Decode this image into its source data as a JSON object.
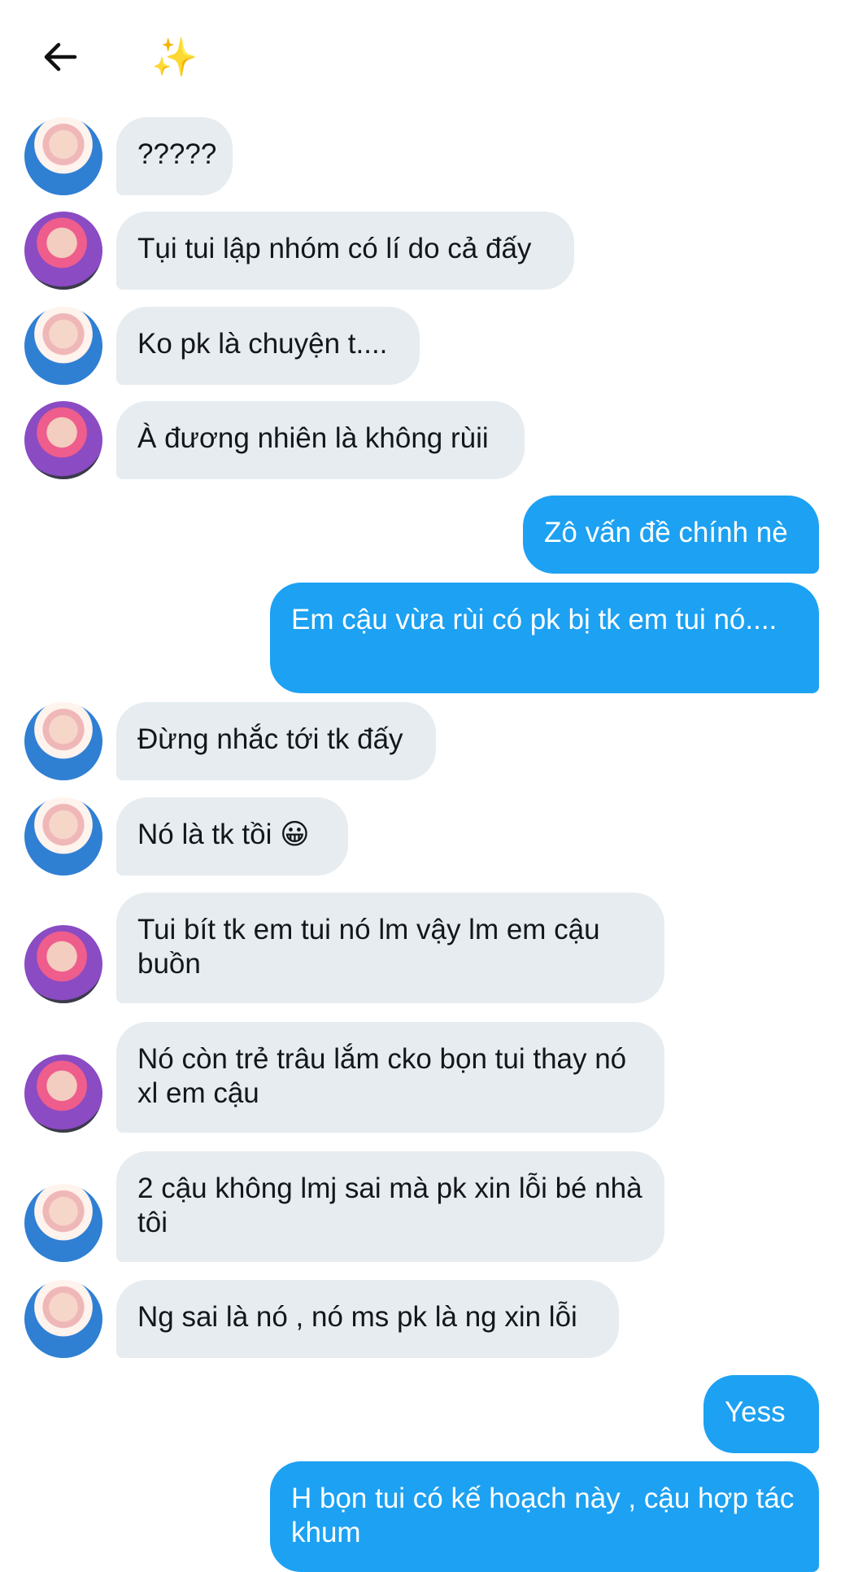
{
  "header": {
    "back_icon": "arrow-left-icon",
    "title": "✨"
  },
  "colors": {
    "incoming_bg": "#e6ecf0",
    "outgoing_bg": "#1da1f2",
    "incoming_text": "#14171a",
    "outgoing_text": "#ffffff"
  },
  "messages": [
    {
      "side": "in",
      "avatar": "a",
      "text": "?????"
    },
    {
      "side": "in",
      "avatar": "b",
      "text": "Tụi tui lập nhóm có lí do cả đấy"
    },
    {
      "side": "in",
      "avatar": "a",
      "text": "Ko pk là chuyện t...."
    },
    {
      "side": "in",
      "avatar": "b",
      "text": "À đương nhiên là không rùii"
    },
    {
      "side": "out",
      "text": "Zô vấn đề chính nè"
    },
    {
      "side": "out",
      "text": "Em cậu vừa rùi có pk bị tk em tui nó...."
    },
    {
      "side": "in",
      "avatar": "a",
      "text": "Đừng nhắc tới tk đấy"
    },
    {
      "side": "in",
      "avatar": "a",
      "text": "Nó là tk tồi 😀"
    },
    {
      "side": "in",
      "avatar": "b",
      "text": "Tui bít tk em tui nó lm vậy lm em cậu buồn"
    },
    {
      "side": "in",
      "avatar": "b",
      "text": "Nó còn trẻ trâu lắm cko bọn tui thay nó xl em cậu"
    },
    {
      "side": "in",
      "avatar": "a",
      "text": "2 cậu không lmj sai mà pk xin lỗi bé nhà tôi"
    },
    {
      "side": "in",
      "avatar": "a",
      "text": "Ng sai là nó , nó ms pk là ng xin lỗi"
    },
    {
      "side": "out",
      "text": "Yess"
    },
    {
      "side": "out",
      "text": "H bọn tui có kế hoạch này , cậu hợp tác khum"
    }
  ]
}
